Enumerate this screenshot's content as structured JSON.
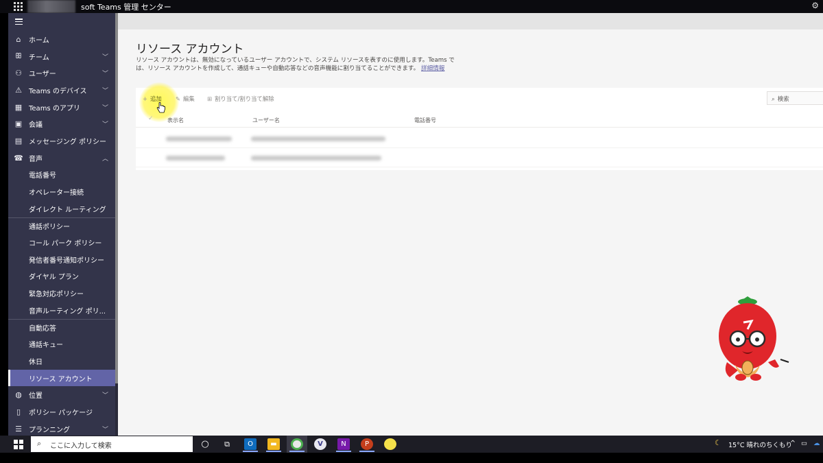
{
  "topbar": {
    "app_title": "soft Teams 管理 センター",
    "waffle_icon": "waffle-icon",
    "settings_icon": "gear-icon"
  },
  "sidebar": {
    "items": [
      {
        "label": "ホーム",
        "icon": "home-icon",
        "glyph": "⌂",
        "chevron": false
      },
      {
        "label": "チーム",
        "icon": "teams-icon",
        "glyph": "ꕥ",
        "chevron": true
      },
      {
        "label": "ユーザー",
        "icon": "users-icon",
        "glyph": "⚇",
        "chevron": true
      },
      {
        "label": "Teams のデバイス",
        "icon": "devices-icon",
        "glyph": "⚠",
        "chevron": true
      },
      {
        "label": "Teams のアプリ",
        "icon": "apps-icon",
        "glyph": "▦",
        "chevron": true
      },
      {
        "label": "会議",
        "icon": "calendar-icon",
        "glyph": "▣",
        "chevron": true
      },
      {
        "label": "メッセージング ポリシー",
        "icon": "message-icon",
        "glyph": "▤",
        "chevron": false
      },
      {
        "label": "音声",
        "icon": "phone-icon",
        "glyph": "☎",
        "chevron": true
      }
    ],
    "voice_sub": [
      {
        "label": "電話番号"
      },
      {
        "label": "オペレーター接続"
      },
      {
        "label": "ダイレクト ルーティング"
      },
      {
        "label": "通話ポリシー",
        "sep": true
      },
      {
        "label": "コール パーク ポリシー"
      },
      {
        "label": "発信者番号通知ポリシー"
      },
      {
        "label": "ダイヤル プラン"
      },
      {
        "label": "緊急対応ポリシー"
      },
      {
        "label": "音声ルーティング ポリ..."
      },
      {
        "label": "自動応答",
        "sep": true
      },
      {
        "label": "通話キュー"
      },
      {
        "label": "休日"
      },
      {
        "label": "リソース アカウント",
        "active": true
      }
    ],
    "bottom_items": [
      {
        "label": "位置",
        "icon": "globe-icon",
        "glyph": "◍",
        "chevron": true
      },
      {
        "label": "ポリシー パッケージ",
        "icon": "package-icon",
        "glyph": "▯",
        "chevron": false
      },
      {
        "label": "プランニング",
        "icon": "planning-icon",
        "glyph": "☰",
        "chevron": true
      }
    ]
  },
  "main": {
    "title": "リソース アカウント",
    "description": "リソース アカウントは、無効になっているユーザー アカウントで、システム リソースを表すのに使用します。Teams では、リソース アカウントを作成して、通話キューや自動応答などの音声機能に割り当てることができます。",
    "learn_more": "詳細情報",
    "toolbar": {
      "add_label": "追加",
      "edit_label": "編集",
      "assign_label": "割り当て/割り当て解除",
      "search_placeholder": "検索"
    },
    "table": {
      "columns": [
        "表示名",
        "ユーザー名",
        "電話番号"
      ],
      "rows": 2
    }
  },
  "taskbar": {
    "search_placeholder": "ここに入力して検索",
    "apps": [
      "cortana-icon",
      "task-view-icon",
      "outlook-icon",
      "file-explorer-icon",
      "chrome-icon",
      "v-app-icon",
      "onenote-icon",
      "powerpoint-icon",
      "sticky-notes-icon"
    ],
    "weather": "15°C  晴れのちくもり",
    "colors": {
      "outlook": "#0f6cbd",
      "onenote": "#7719aa",
      "powerpoint": "#c43e1c",
      "chrome": "#4caf50",
      "explorer": "#f2b81f"
    }
  }
}
